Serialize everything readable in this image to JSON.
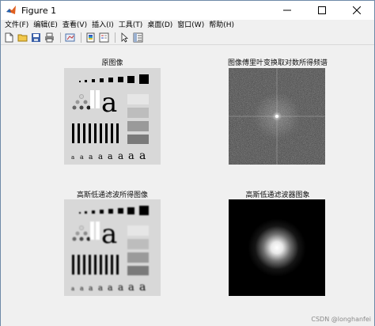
{
  "window": {
    "title": "Figure 1",
    "controls": {
      "minimize": "minimize",
      "maximize": "maximize",
      "close": "close"
    }
  },
  "menu": [
    "文件(F)",
    "编辑(E)",
    "查看(V)",
    "插入(I)",
    "工具(T)",
    "桌面(D)",
    "窗口(W)",
    "帮助(H)"
  ],
  "toolbar": [
    "new-figure",
    "open-file",
    "save",
    "print",
    "link-plot",
    "insert-colorbar",
    "insert-legend",
    "edit-plot",
    "property-inspector"
  ],
  "panels": {
    "original": {
      "title": "原图像",
      "glyph": "a",
      "small_glyphs": [
        "a",
        "a",
        "a",
        "a",
        "a",
        "a",
        "a",
        "a",
        "a"
      ]
    },
    "spectrum": {
      "title": "图像傅里叶变换取对数所得频谱"
    },
    "filtered": {
      "title": "高斯低通滤波所得图像",
      "glyph": "a",
      "small_glyphs": [
        "a",
        "a",
        "a",
        "a",
        "a",
        "a",
        "a",
        "a",
        "a"
      ]
    },
    "filter": {
      "title": "高斯低通滤波器图象"
    }
  },
  "watermark": "CSDN @longhanfei"
}
